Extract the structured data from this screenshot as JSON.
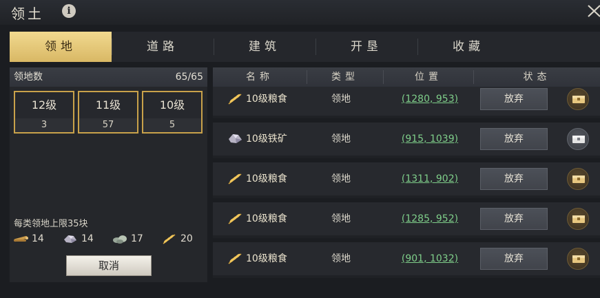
{
  "window": {
    "title": "领土"
  },
  "tabs": [
    {
      "label": "领地",
      "active": true
    },
    {
      "label": "道路",
      "active": false
    },
    {
      "label": "建筑",
      "active": false
    },
    {
      "label": "开垦",
      "active": false
    },
    {
      "label": "收藏",
      "active": false
    }
  ],
  "summary": {
    "label": "领地数",
    "value": "65/65",
    "levels": [
      {
        "level": "12级",
        "count": "3"
      },
      {
        "level": "11级",
        "count": "57"
      },
      {
        "level": "10级",
        "count": "5"
      }
    ],
    "limit_text": "每类领地上限35块",
    "resources": [
      {
        "icon": "wood-icon",
        "count": "14"
      },
      {
        "icon": "iron-ore-icon",
        "count": "14"
      },
      {
        "icon": "stone-icon",
        "count": "17"
      },
      {
        "icon": "grain-icon",
        "count": "20"
      }
    ],
    "cancel_label": "取消"
  },
  "table": {
    "headers": [
      "名称",
      "类型",
      "位置",
      "状态"
    ],
    "rows": [
      {
        "name": "10级粮食",
        "icon": "grain-icon",
        "type": "领地",
        "position": "(1280, 953)",
        "action": "放弃"
      },
      {
        "name": "10级铁矿",
        "icon": "iron-ore-icon",
        "type": "领地",
        "position": "(915, 1039)",
        "action": "放弃"
      },
      {
        "name": "10级粮食",
        "icon": "grain-icon",
        "type": "领地",
        "position": "(1311, 902)",
        "action": "放弃"
      },
      {
        "name": "10级粮食",
        "icon": "grain-icon",
        "type": "领地",
        "position": "(1285, 952)",
        "action": "放弃"
      },
      {
        "name": "10级粮食",
        "icon": "grain-icon",
        "type": "领地",
        "position": "(901, 1032)",
        "action": "放弃"
      }
    ]
  },
  "colors": {
    "accent_gold": "#d9b865",
    "coordinate_green": "#7fcf8a",
    "panel_bg": "#25272b"
  }
}
